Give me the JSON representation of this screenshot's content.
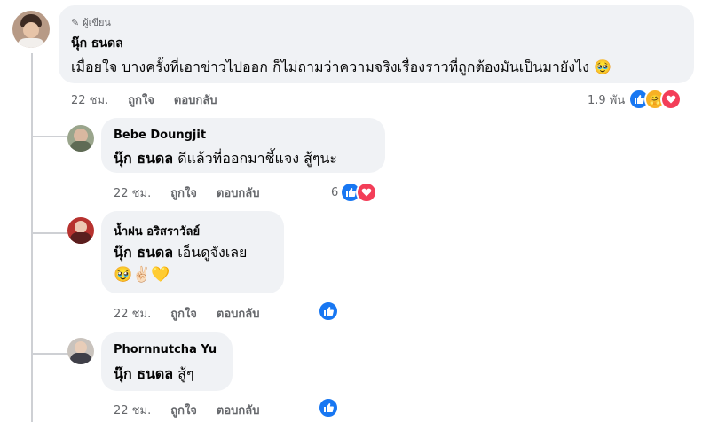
{
  "comment": {
    "badge": "ผู้เขียน",
    "author": "นุ๊ก ธนดล",
    "text": "เมื่อยใจ บางครั้งที่เอาข่าวไปออก ก็ไม่ถามว่าความจริงเรื่องราวที่ถูกต้องมันเป็นมายังไง 🥹",
    "time": "22 ชม.",
    "like": "ถูกใจ",
    "reply": "ตอบกลับ",
    "reaction_count": "1.9 พัน"
  },
  "replies": [
    {
      "author": "Bebe Doungjit",
      "mention": "นุ๊ก ธนดล",
      "text": "ดีแล้วที่ออกมาชี้แจง สู้ๆนะ",
      "time": "22 ชม.",
      "like": "ถูกใจ",
      "reply": "ตอบกลับ",
      "reaction_count": "6"
    },
    {
      "author": "น้ำฝน อริสราวัลย์",
      "mention": "นุ๊ก ธนดล",
      "text": "เอ็นดูจังเลย",
      "extra": "🥹✌🏻💛",
      "time": "22 ชม.",
      "like": "ถูกใจ",
      "reply": "ตอบกลับ",
      "reaction_count": ""
    },
    {
      "author": "Phornnutcha Yu",
      "mention": "นุ๊ก ธนดล",
      "text": "สู้ๆ",
      "time": "22 ชม.",
      "like": "ถูกใจ",
      "reply": "ตอบกลับ",
      "reaction_count": ""
    }
  ],
  "colors": {
    "like": "#1877f2",
    "love": "#f33e58",
    "care": "#f7b125"
  }
}
